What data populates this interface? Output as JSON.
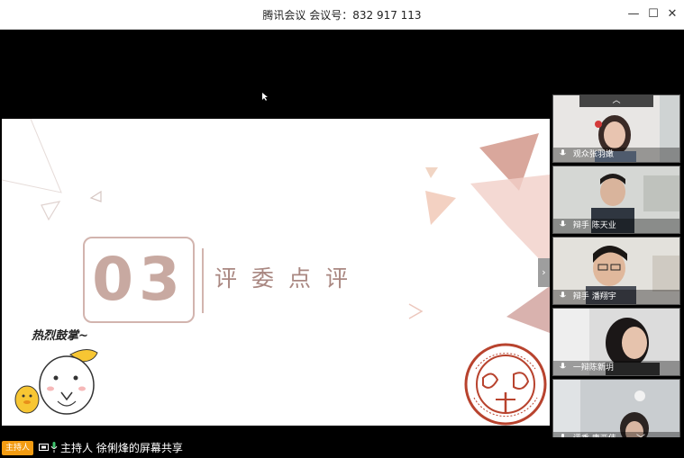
{
  "window": {
    "title": "腾讯会议 会议号：832 917 113",
    "minimize_glyph": "—",
    "maximize_glyph": "☐",
    "close_glyph": "✕"
  },
  "slide": {
    "number": "03",
    "heading": "评委点评",
    "applause_text": "热烈鼓掌~",
    "side_toggle_glyph": "›"
  },
  "panel": {
    "collapse_glyph": "︿",
    "participants": [
      {
        "label": "观众张羽嫩"
      },
      {
        "label": "辩手 陈天业"
      },
      {
        "label": "辩手 潘翔宇"
      },
      {
        "label": "一辩陈新玥"
      },
      {
        "label": "评委 唐亚伟"
      }
    ],
    "expand_glyph": "﹀"
  },
  "statusbar": {
    "host_badge": "主持人",
    "share_text": "主持人 徐俐烽的屏幕共享"
  },
  "colors": {
    "accent_rose": "#c8a9a1",
    "seal_red": "#b8432e",
    "host_orange": "#f39c12"
  },
  "icons": [
    "minimize-icon",
    "maximize-icon",
    "close-icon",
    "mouse-cursor-icon",
    "mic-icon",
    "screen-share-icon",
    "chevron-up-icon",
    "chevron-down-icon",
    "chevron-right-icon"
  ]
}
